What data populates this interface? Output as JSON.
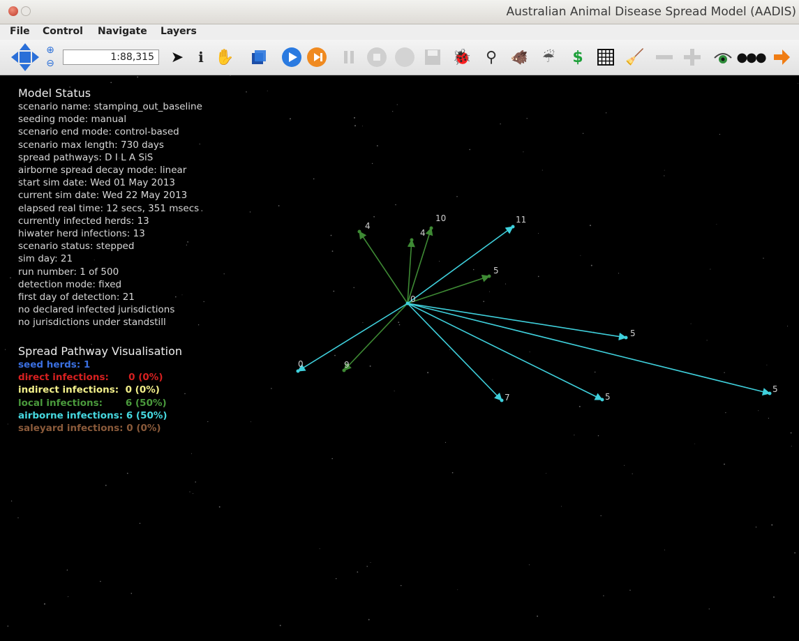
{
  "window": {
    "title": "Australian Animal Disease Spread Model (AADIS)"
  },
  "menu": [
    "File",
    "Control",
    "Navigate",
    "Layers"
  ],
  "toolbar": {
    "scale": "1:88,315"
  },
  "model_status": {
    "header": "Model Status",
    "lines": [
      "scenario name: stamping_out_baseline",
      "seeding mode: manual",
      "scenario end mode: control-based",
      "scenario max length: 730 days",
      "spread pathways: D I L A SiS",
      "airborne spread decay mode: linear",
      "start sim date: Wed 01 May 2013",
      "current sim date: Wed 22 May 2013",
      "elapsed real time: 12 secs, 351 msecs",
      "currently infected herds: 13",
      "hiwater herd infections: 13",
      "scenario status: stepped",
      "sim day: 21",
      "run number: 1 of 500",
      "detection mode: fixed",
      "first day of detection: 21",
      "no declared infected jurisdictions",
      "no jurisdictions under standstill"
    ]
  },
  "spread": {
    "header": "Spread Pathway Visualisation",
    "items": [
      {
        "text": "seed herds: 1",
        "color": "#3a6fe0"
      },
      {
        "text": "direct infections:      0 (0%)",
        "color": "#d62020"
      },
      {
        "text": "indirect infections:  0 (0%)",
        "color": "#f2ef8a"
      },
      {
        "text": "local infections:       6 (50%)",
        "color": "#4a9a3c"
      },
      {
        "text": "airborne infections: 6 (50%)",
        "color": "#46d8e0"
      },
      {
        "text": "saleyard infections: 0 (0%)",
        "color": "#8a5a3a"
      }
    ]
  },
  "network": {
    "origin_label": "0",
    "edges": [
      {
        "label": "4",
        "type": "local"
      },
      {
        "label": "4",
        "type": "local"
      },
      {
        "label": "10",
        "type": "local"
      },
      {
        "label": "5",
        "type": "local"
      },
      {
        "label": "9",
        "type": "local"
      },
      {
        "label": "11",
        "type": "airborne"
      },
      {
        "label": "5",
        "type": "airborne"
      },
      {
        "label": "5",
        "type": "airborne"
      },
      {
        "label": "5",
        "type": "airborne"
      },
      {
        "label": "7",
        "type": "airborne"
      },
      {
        "label": "0",
        "type": "airborne"
      }
    ],
    "colors": {
      "local": "#3e8a34",
      "airborne": "#3fd0dc"
    }
  }
}
